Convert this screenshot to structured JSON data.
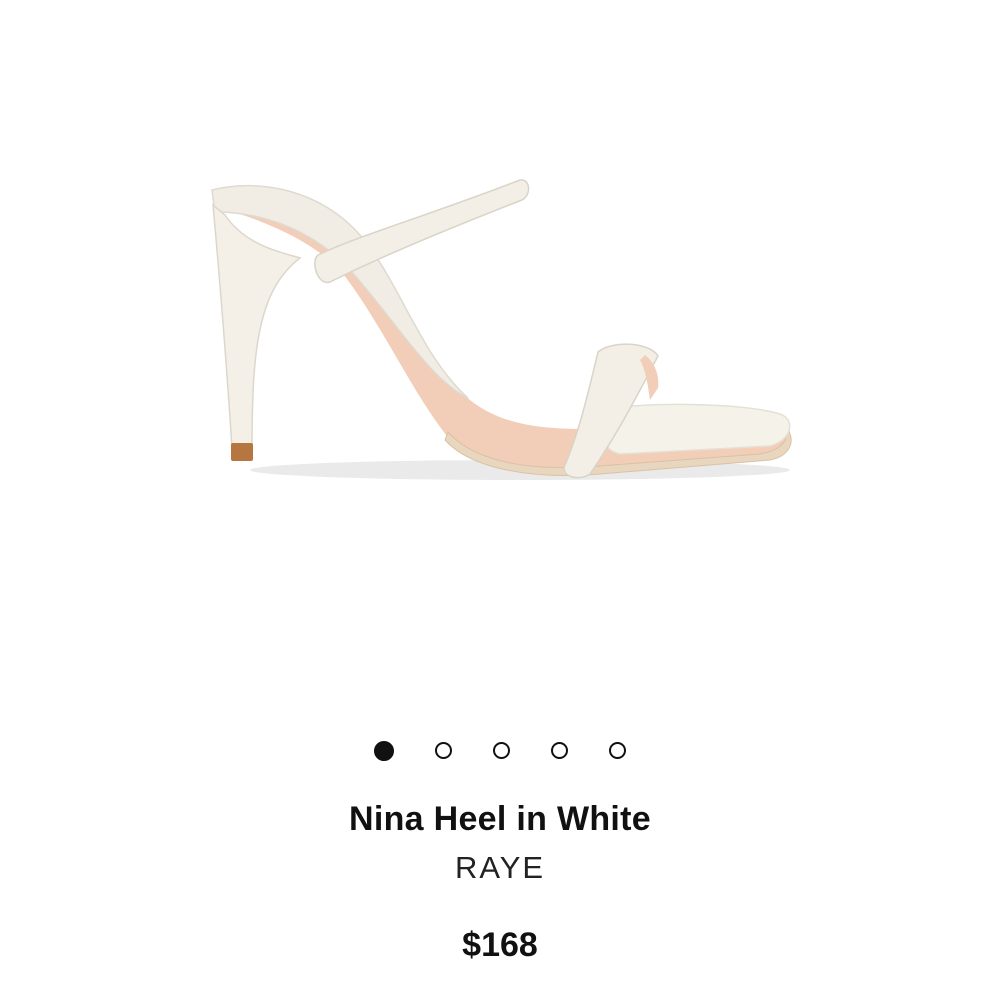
{
  "product": {
    "name": "Nina Heel in White",
    "brand": "RAYE",
    "price": "$168",
    "image_alt": "white strappy heel sandal"
  },
  "carousel": {
    "total_slides": 5,
    "active_index": 0
  },
  "colors": {
    "text": "#111111",
    "dot_active": "#111111",
    "shoe_leather": "#f3efe6",
    "shoe_lining": "#f2cdb8",
    "heel_tip": "#b5773f"
  }
}
